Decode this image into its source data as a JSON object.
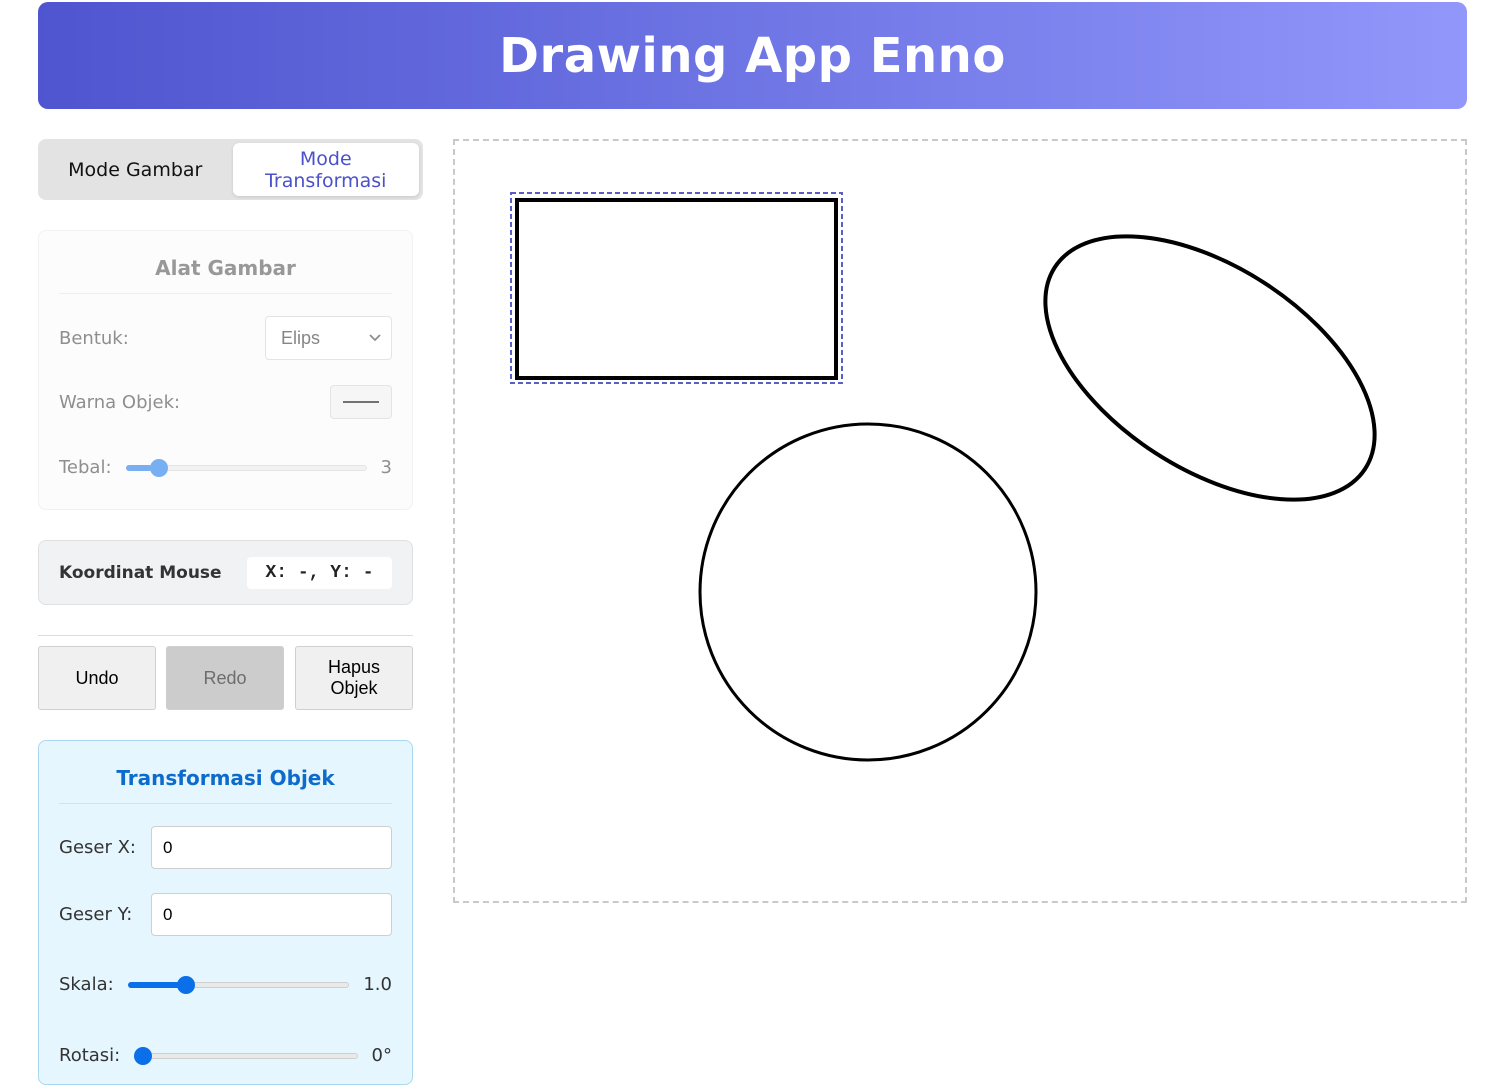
{
  "app": {
    "title": "Drawing App Enno"
  },
  "modes": [
    {
      "label": "Mode Gambar",
      "active": false
    },
    {
      "label": "Mode Transformasi",
      "active": true
    }
  ],
  "drawing_tools": {
    "title": "Alat Gambar",
    "shape_label": "Bentuk:",
    "shape_value": "Elips",
    "color_label": "Warna Objek:",
    "color_value": "#000000",
    "thickness_label": "Tebal:",
    "thickness_value": "3",
    "thickness_fraction": 0.11
  },
  "mouse_coords": {
    "label": "Koordinat Mouse",
    "value": "X: -, Y: -"
  },
  "actions": {
    "undo": "Undo",
    "redo": "Redo",
    "delete": "Hapus Objek"
  },
  "transform": {
    "title": "Transformasi Objek",
    "shift_x_label": "Geser X:",
    "shift_x_value": "0",
    "shift_y_label": "Geser Y:",
    "shift_y_value": "0",
    "scale_label": "Skala:",
    "scale_value": "1.0",
    "scale_fraction": 0.24,
    "rotate_label": "Rotasi:",
    "rotate_value": "0°",
    "rotate_fraction": 0.0
  },
  "canvas": {
    "objects": [
      {
        "type": "rectangle",
        "selected": true
      },
      {
        "type": "ellipse",
        "selected": false
      },
      {
        "type": "circle",
        "selected": false
      }
    ],
    "stroke_color": "#000000",
    "selection_color": "#5a5fc7"
  }
}
